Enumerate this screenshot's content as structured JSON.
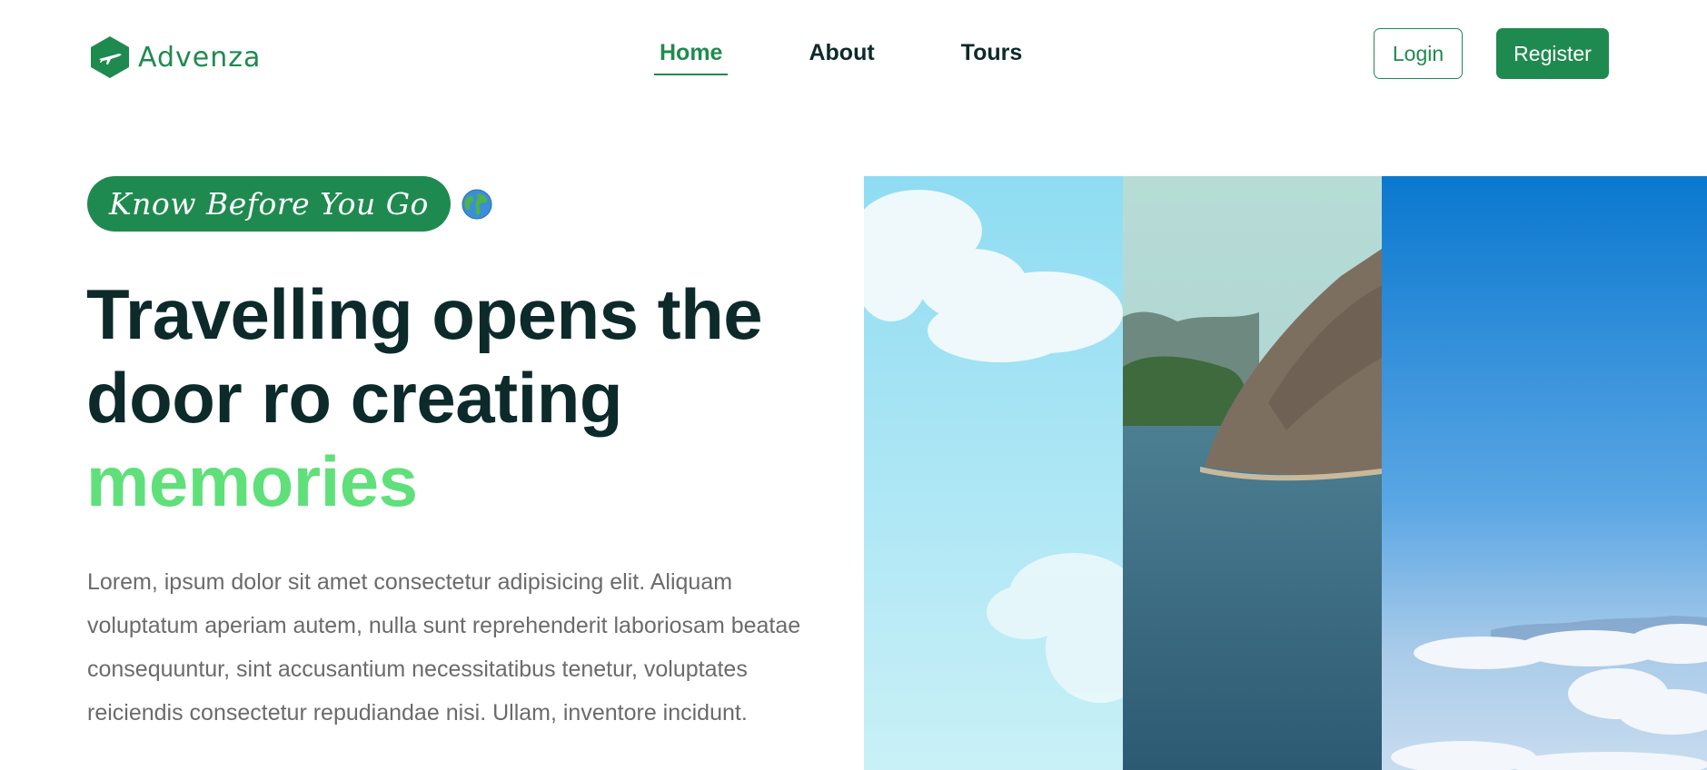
{
  "brand": {
    "name": "Advenza",
    "logo_icon": "plane-hexagon-icon"
  },
  "nav": {
    "items": [
      {
        "label": "Home",
        "active": true
      },
      {
        "label": "About",
        "active": false
      },
      {
        "label": "Tours",
        "active": false
      }
    ]
  },
  "auth": {
    "login_label": "Login",
    "register_label": "Register"
  },
  "hero": {
    "tag": "Know Before You Go",
    "tag_icon": "globe-icon",
    "headline_line1": "Travelling opens the",
    "headline_line2": "door ro creating",
    "headline_accent": "memories",
    "description": "Lorem, ipsum dolor sit amet consectetur adipisicing elit. Aliquam voluptatum aperiam autem, nulla sunt reprehenderit laboriosam beatae consequuntur, sint accusantium necessitatibus tenetur, voluptates reiciendis consectetur repudiandae nisi. Ullam, inventore incidunt."
  },
  "colors": {
    "brand_green": "#1f8a4f",
    "accent_green": "#5fe07a",
    "heading": "#0d2a2b",
    "body_text": "#6b6b6b"
  }
}
